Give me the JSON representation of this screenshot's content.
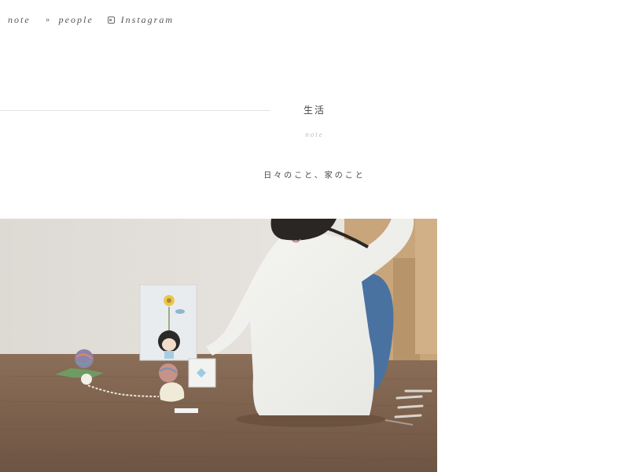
{
  "nav": {
    "items": [
      {
        "label": "note",
        "icon": "double-chevron-right-icon"
      },
      {
        "label": "people",
        "icon": "double-chevron-right-icon"
      },
      {
        "label": "Instagram",
        "icon": "instagram-icon"
      }
    ]
  },
  "section": {
    "title": "生活",
    "subtitle": "note",
    "description": "日々のこと、家のこと"
  },
  "colors": {
    "text": "#555555",
    "divider": "#e2e2e2",
    "subtitle": "#bbbbbb"
  }
}
